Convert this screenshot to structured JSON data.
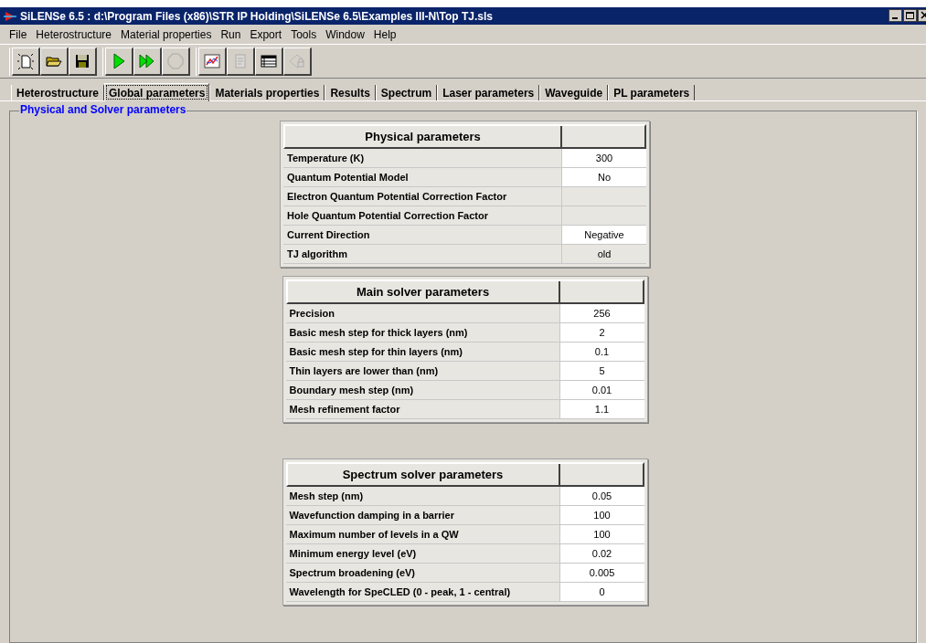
{
  "window": {
    "title": "SiLENSe 6.5  :  d:\\Program Files (x86)\\STR IP Holding\\SiLENSe 6.5\\Examples III-N\\Top TJ.sls"
  },
  "menu": [
    "File",
    "Heterostructure",
    "Material properties",
    "Run",
    "Export",
    "Tools",
    "Window",
    "Help"
  ],
  "toolbar": [
    {
      "kind": "new",
      "disabled": false
    },
    {
      "kind": "open",
      "disabled": false
    },
    {
      "kind": "save",
      "disabled": false
    },
    {
      "kind": "run",
      "disabled": false
    },
    {
      "kind": "runall",
      "disabled": false
    },
    {
      "kind": "stop",
      "disabled": true
    },
    {
      "kind": "chart",
      "disabled": false
    },
    {
      "kind": "doc",
      "disabled": true
    },
    {
      "kind": "table",
      "disabled": false
    },
    {
      "kind": "lock",
      "disabled": true
    }
  ],
  "tabs": [
    {
      "label": "Heterostructure",
      "selected": false
    },
    {
      "label": "Global parameters",
      "selected": true
    },
    {
      "label": "Materials properties",
      "selected": false
    },
    {
      "label": "Results",
      "selected": false
    },
    {
      "label": "Spectrum",
      "selected": false
    },
    {
      "label": "Laser parameters",
      "selected": false
    },
    {
      "label": "Waveguide",
      "selected": false
    },
    {
      "label": "PL parameters",
      "selected": false
    }
  ],
  "group_box": {
    "title": "Physical and Solver parameters"
  },
  "tables": [
    {
      "title": "Physical parameters",
      "rows": [
        {
          "label": "Temperature (K)",
          "value": "300",
          "editable": true
        },
        {
          "label": "Quantum Potential Model",
          "value": "No",
          "editable": true
        },
        {
          "label": "Electron Quantum Potential Correction Factor",
          "editable": false
        },
        {
          "label": "Hole Quantum Potential Correction Factor",
          "editable": false
        },
        {
          "label": "Current Direction",
          "value": "Negative",
          "editable": true
        },
        {
          "label": "TJ algorithm",
          "value": "old",
          "editable": false
        }
      ]
    },
    {
      "title": "Main solver parameters",
      "rows": [
        {
          "label": "Precision",
          "value": "256",
          "editable": true
        },
        {
          "label": "Basic mesh step for thick layers (nm)",
          "value": "2",
          "editable": true
        },
        {
          "label": "Basic mesh step for thin layers (nm)",
          "value": "0.1",
          "editable": true
        },
        {
          "label": "Thin layers are lower than (nm)",
          "value": "5",
          "editable": true
        },
        {
          "label": "Boundary mesh step (nm)",
          "value": "0.01",
          "editable": true
        },
        {
          "label": "Mesh refinement factor",
          "value": "1.1",
          "editable": true
        }
      ]
    },
    {
      "title": "Spectrum solver parameters",
      "rows": [
        {
          "label": "Mesh step (nm)",
          "value": "0.05",
          "editable": true
        },
        {
          "label": "Wavefunction damping in a barrier",
          "value": "100",
          "editable": true
        },
        {
          "label": "Maximum number of levels in a QW",
          "value": "100",
          "editable": true
        },
        {
          "label": "Minimum energy level (eV)",
          "value": "0.02",
          "editable": true
        },
        {
          "label": "Spectrum broadening (eV)",
          "value": "0.005",
          "editable": true
        },
        {
          "label": "Wavelength for SpeCLED (0 - peak, 1 - central)",
          "value": "0",
          "editable": true
        }
      ]
    }
  ]
}
